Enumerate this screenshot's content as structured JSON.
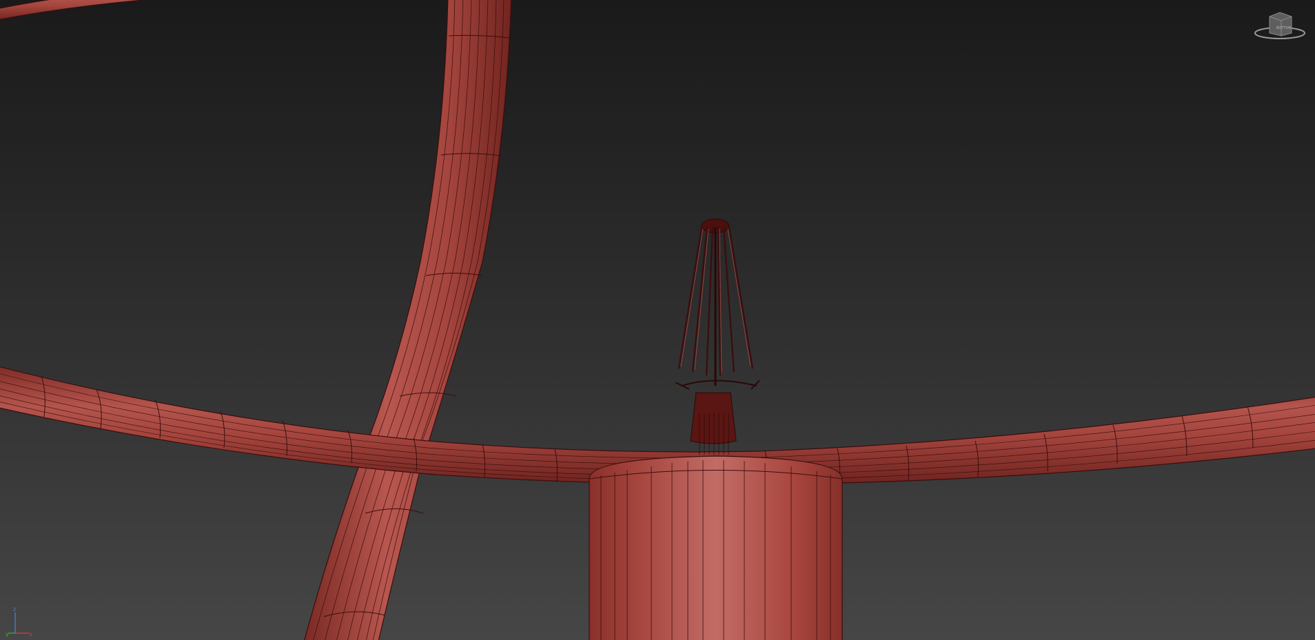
{
  "viewport": {
    "background_top": "#1a1a1a",
    "background_bottom": "#464646",
    "mesh_color": "#a8463f",
    "mesh_highlight": "#c66a62",
    "wire_color": "#3a0d0c"
  },
  "viewcube": {
    "icon": "viewcube-icon",
    "face_label": "BOTTOM"
  },
  "axis_tripod": {
    "icon": "axis-tripod-icon",
    "x_label": "x",
    "y_label": "y",
    "z_label": "z",
    "x_color": "#d04040",
    "y_color": "#40b040",
    "z_color": "#5080e0"
  }
}
